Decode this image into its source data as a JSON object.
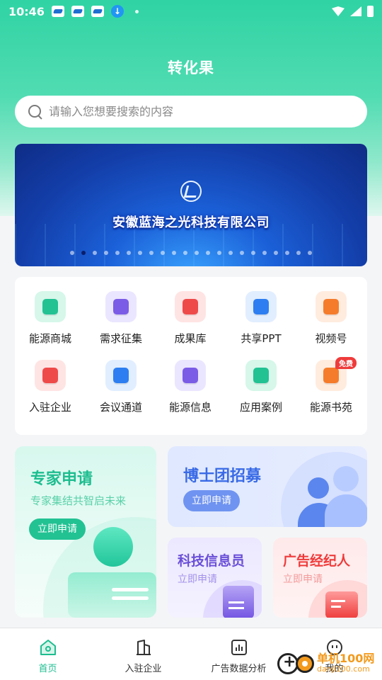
{
  "status_bar": {
    "time": "10:46",
    "download_glyph": "↓"
  },
  "header": {
    "title": "转化果"
  },
  "search": {
    "placeholder": "请输入您想要搜索的内容"
  },
  "banner": {
    "caption": "安徽蓝海之光科技有限公司",
    "page_count": 22,
    "active_index": 1
  },
  "grid": {
    "items": [
      {
        "label": "能源商城",
        "icon": "shop-icon",
        "bg": "#d6f7ea",
        "color": "#22c293"
      },
      {
        "label": "需求征集",
        "icon": "document-list-icon",
        "bg": "#ebe6ff",
        "color": "#7b5ce6"
      },
      {
        "label": "成果库",
        "icon": "folder-star-icon",
        "bg": "#ffe4e4",
        "color": "#ef4a4a"
      },
      {
        "label": "共享PPT",
        "icon": "ppt-icon",
        "bg": "#e1eeff",
        "color": "#2d7ef0"
      },
      {
        "label": "视频号",
        "icon": "video-icon",
        "bg": "#ffecdf",
        "color": "#f57c2b"
      },
      {
        "label": "入驻企业",
        "icon": "building-icon",
        "bg": "#ffe4e4",
        "color": "#ef4a4a"
      },
      {
        "label": "会议通道",
        "icon": "users-icon",
        "bg": "#e1eeff",
        "color": "#2d7ef0"
      },
      {
        "label": "能源信息",
        "icon": "recycle-icon",
        "bg": "#ebe6ff",
        "color": "#7b5ce6"
      },
      {
        "label": "应用案例",
        "icon": "books-icon",
        "bg": "#d6f7ea",
        "color": "#22c293"
      },
      {
        "label": "能源书苑",
        "icon": "book-icon",
        "bg": "#ffecdf",
        "color": "#f57c2b",
        "badge": "免费"
      }
    ]
  },
  "promos": {
    "expert": {
      "title": "专家申请",
      "subtitle": "专家集结共智启未来",
      "button": "立即申请"
    },
    "phd": {
      "title": "博士团招募",
      "button": "立即申请"
    },
    "tech": {
      "title": "科技信息员",
      "subtitle": "立即申请"
    },
    "ad": {
      "title": "广告经纪人",
      "subtitle": "立即申请"
    }
  },
  "tabbar": {
    "tabs": [
      {
        "label": "首页",
        "icon": "home-icon",
        "active": true
      },
      {
        "label": "入驻企业",
        "icon": "building-icon",
        "active": false
      },
      {
        "label": "广告数据分析",
        "icon": "bar-chart-icon",
        "active": false
      },
      {
        "label": "我的",
        "icon": "profile-icon",
        "active": false
      }
    ]
  },
  "watermark": {
    "brand": "单机100网",
    "url": "danji100.com"
  },
  "colors": {
    "accent": "#1dbd8f",
    "header_top": "#2fd3a4"
  }
}
